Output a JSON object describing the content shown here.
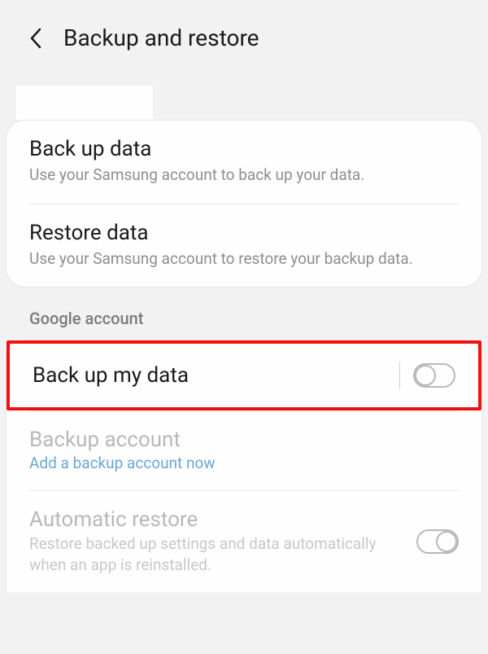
{
  "header": {
    "title": "Backup and restore"
  },
  "samsung": {
    "backup": {
      "title": "Back up data",
      "subtitle": "Use your Samsung account to back up your data."
    },
    "restore": {
      "title": "Restore data",
      "subtitle": "Use your Samsung account to restore your backup data."
    }
  },
  "google": {
    "section_label": "Google account",
    "backup_my_data": {
      "title": "Back up my data"
    },
    "backup_account": {
      "title": "Backup account",
      "link": "Add a backup account now"
    },
    "auto_restore": {
      "title": "Automatic restore",
      "subtitle": "Restore backed up settings and data automatically when an app is reinstalled."
    }
  }
}
